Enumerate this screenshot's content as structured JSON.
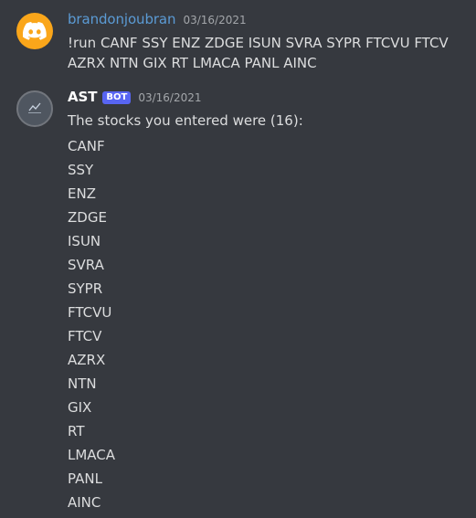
{
  "messages": [
    {
      "author": "brandonjoubran",
      "timestamp": "03/16/2021",
      "text": "!run CANF SSY ENZ ZDGE ISUN SVRA SYPR FTCVU FTCV AZRX NTN GIX RT LMACA PANL AINC",
      "avatar_icon": "discord-logo-icon"
    },
    {
      "author": "AST",
      "bot_tag": "BOT",
      "timestamp": "03/16/2021",
      "intro": "The stocks you entered were (16):",
      "avatar_icon": "ast-avatar-icon",
      "stocks": [
        "CANF",
        "SSY",
        "ENZ",
        "ZDGE",
        "ISUN",
        "SVRA",
        "SYPR",
        "FTCVU",
        "FTCV",
        "AZRX",
        "NTN",
        "GIX",
        "RT",
        "LMACA",
        "PANL",
        "AINC"
      ]
    }
  ],
  "colors": {
    "background": "#36393f",
    "user_name": "#5b9bd5",
    "bot_tag": "#5865f2",
    "avatar_discord": "#faa61a"
  }
}
